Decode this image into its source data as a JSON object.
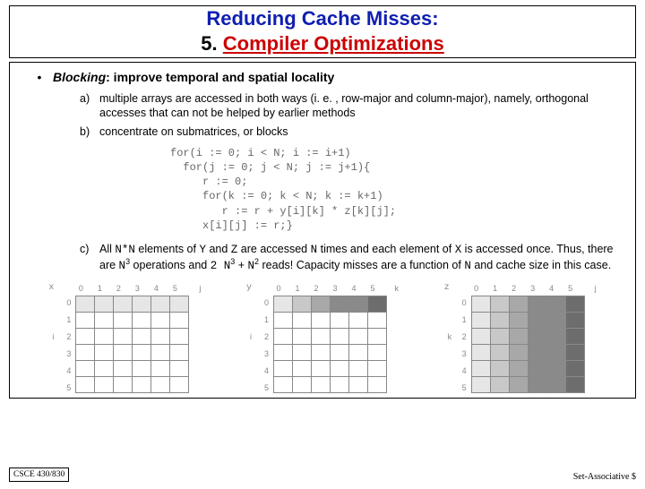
{
  "title": {
    "line1": "Reducing Cache Misses:",
    "num": "5.",
    "line2": "Compiler Optimizations"
  },
  "bullet": {
    "marker": "•",
    "term": "Blocking",
    "rest": ": improve temporal and spatial locality"
  },
  "items": {
    "a": {
      "marker": "a)",
      "text": "multiple arrays are accessed in both ways (i. e. , row-major and column-major), namely, orthogonal accesses that can not be helped by earlier methods"
    },
    "b": {
      "marker": "b)",
      "text": "concentrate on submatrices, or blocks"
    },
    "c": {
      "marker": "c)",
      "parts": {
        "s1": "All ",
        "v_nn1": "N*N",
        "s2": " elements of ",
        "v_y": "Y",
        "s3": " and ",
        "v_z": "Z",
        "s4": " are accessed ",
        "v_n1": "N",
        "s5": " times and each element of ",
        "v_x": "X",
        "s6": " is accessed once. Thus, there are ",
        "v_n2": "N",
        "exp3a": "3",
        "s7": " operations and ",
        "v_2n": "2 N",
        "exp3b": "3",
        "s8": " + ",
        "v_n3": "N",
        "exp2": "2",
        "s9": " reads! Capacity misses are a function of ",
        "v_n4": "N",
        "s10": " and cache size in this case."
      }
    }
  },
  "code": "for(i := 0; i < N; i := i+1)\n  for(j := 0; j < N; j := j+1){\n     r := 0;\n     for(k := 0; k < N; k := k+1)\n        r := r + y[i][k] * z[k][j];\n     x[i][j] := r;}",
  "grids": {
    "col_labels": [
      "0",
      "1",
      "2",
      "3",
      "4",
      "5"
    ],
    "row_labels": [
      "0",
      "1",
      "2",
      "3",
      "4",
      "5"
    ],
    "j_label": "j",
    "i_label": "i",
    "k_label": "k",
    "x": {
      "name": "x",
      "side_left": "i",
      "top_right": "j",
      "cells": [
        [
          "c1",
          "c1",
          "c1",
          "c1",
          "c1",
          "c1"
        ],
        [
          "c0",
          "c0",
          "c0",
          "c0",
          "c0",
          "c0"
        ],
        [
          "c0",
          "c0",
          "c0",
          "c0",
          "c0",
          "c0"
        ],
        [
          "c0",
          "c0",
          "c0",
          "c0",
          "c0",
          "c0"
        ],
        [
          "c0",
          "c0",
          "c0",
          "c0",
          "c0",
          "c0"
        ],
        [
          "c0",
          "c0",
          "c0",
          "c0",
          "c0",
          "c0"
        ]
      ]
    },
    "y": {
      "name": "y",
      "side_left": "i",
      "top_right": "k",
      "cells": [
        [
          "c1",
          "c2",
          "c3",
          "c4",
          "c4",
          "c5"
        ],
        [
          "c0",
          "c0",
          "c0",
          "c0",
          "c0",
          "c0"
        ],
        [
          "c0",
          "c0",
          "c0",
          "c0",
          "c0",
          "c0"
        ],
        [
          "c0",
          "c0",
          "c0",
          "c0",
          "c0",
          "c0"
        ],
        [
          "c0",
          "c0",
          "c0",
          "c0",
          "c0",
          "c0"
        ],
        [
          "c0",
          "c0",
          "c0",
          "c0",
          "c0",
          "c0"
        ]
      ]
    },
    "z": {
      "name": "z",
      "side_left": "k",
      "top_right": "j",
      "cells": [
        [
          "c1",
          "c2",
          "c3",
          "c4",
          "c4",
          "c5"
        ],
        [
          "c1",
          "c2",
          "c3",
          "c4",
          "c4",
          "c5"
        ],
        [
          "c1",
          "c2",
          "c3",
          "c4",
          "c4",
          "c5"
        ],
        [
          "c1",
          "c2",
          "c3",
          "c4",
          "c4",
          "c5"
        ],
        [
          "c1",
          "c2",
          "c3",
          "c4",
          "c4",
          "c5"
        ],
        [
          "c1",
          "c2",
          "c3",
          "c4",
          "c4",
          "c5"
        ]
      ]
    }
  },
  "footer": {
    "left": "CSCE 430/830",
    "right": "Set-Associative $"
  }
}
